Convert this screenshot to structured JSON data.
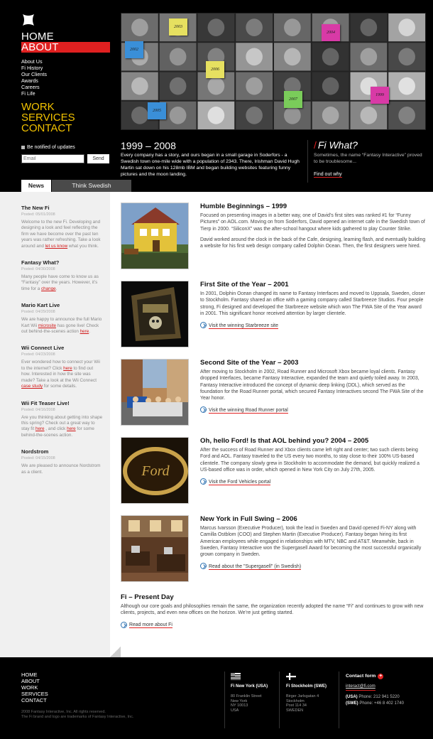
{
  "header": {
    "nav_main": [
      "HOME",
      "ABOUT"
    ],
    "sub_nav": [
      "About Us",
      "Fi History",
      "Our Clients",
      "Awards",
      "Careers",
      "Fi Life"
    ],
    "nav_lower": [
      "WORK",
      "SERVICES",
      "CONTACT"
    ],
    "notify_label": "Be notified of updates",
    "email_placeholder": "Email",
    "send_label": "Send",
    "tabs": [
      "News",
      "Think Swedish"
    ],
    "collage_notes": [
      "2002",
      "2003",
      "2004",
      "2006",
      "2005",
      "2007",
      "1999"
    ],
    "colors": {
      "accent": "#e02020",
      "nav_yellow": "#f2c200",
      "note_blue": "#3a8fd8",
      "note_yellow": "#e6e060",
      "note_pink": "#d83aa6",
      "note_green": "#7acc5a"
    }
  },
  "hero": {
    "year": "1999 – 2008",
    "text": "Every company has a story, and ours began in a small garage in Soderfors - a Swedish town one-mile wide with a population of 2343. There, Irishman David Hugh Martin sat down on his 128mb IBM and began building websites featuring funny pictures and the moon landing."
  },
  "whatfi": {
    "title": "Fi What?",
    "text": "Sometimes, the name “Fantasy Interactive” proved to be troublesome...",
    "link": "Find out why"
  },
  "news": [
    {
      "title": "The New Fi",
      "date": "Posted: 05/01/2008",
      "pre": "Welcome to the new Fi. Developing and designing a look and feel reflecting the firm we have become over the past ten years was rather refreshing. Take a look around and ",
      "link": "let us know",
      "post": " what you think."
    },
    {
      "title": "Fantasy What?",
      "date": "Posted: 04/30/2008",
      "pre": "Many people have come to know us as “Fantasy” over the years. However, it’s time for a ",
      "link": "change",
      "post": "."
    },
    {
      "title": "Mario Kart Live",
      "date": "Posted: 04/29/2008",
      "pre": "We are happy to announce the full Mario Kart Wii ",
      "link": "microsite",
      "post": " has gone live! Check out behind-the-scenes action ",
      "link2": "here",
      "post2": "."
    },
    {
      "title": "Wii Connect Live",
      "date": "Posted: 04/23/2008",
      "pre": "Ever wondered how to connect your Wii to the internet? Click ",
      "link": "here",
      "post": " to find out how. Interested in how the site was made? Take a look at the Wii Connect ",
      "link2": "case study",
      "post2": " for some details."
    },
    {
      "title": "Wii Fit Teaser Live!",
      "date": "Posted: 04/16/2008",
      "pre": "Are you thinking about getting into shape this spring? Check out a great way to stay fit ",
      "link": "here",
      "post": " , and click ",
      "link2": "here",
      "post2": " for some behind-the-scenes action."
    },
    {
      "title": "Nordstrom",
      "date": "Posted: 04/15/2008",
      "pre": "We are pleased to announce Nordstrom as a client.",
      "link": "",
      "post": ""
    }
  ],
  "stories": [
    {
      "title": "Humble Beginnings – 1999",
      "paragraphs": [
        "Focused on presenting images in a better way, one of David’s first sites was ranked #1 for “Funny Pictures” on AOL.com. Moving on from Soderfors, David opened an internet cafe in the Swedish town of Tierp in 2000. “SiliconX” was the after-school hangout where kids gathered to play Counter Strike.",
        "David worked around the clock in the back of the Cafe, designing, learning flash, and eventually building a website for his first web design company called Dolphin Ocean. Then, the first designers were hired."
      ],
      "link": ""
    },
    {
      "title": "First Site of the Year – 2001",
      "paragraphs": [
        "In 2001, Dolphin Ocean changed its name to Fantasy Interfaces and moved to Uppsala, Sweden, closer to Stockholm. Fantasy shared an office with a gaming company called Starbreeze Studios. Four people strong, Fi designed and developed the Starbreeze website which won The FWA Site of the Year award in 2001. This significant honor received attention by larger clientele."
      ],
      "link": "Visit the winning Starbreeze site"
    },
    {
      "title": "Second Site of the Year – 2003",
      "paragraphs": [
        "After moving to Stockholm in 2002, Road Runner and Microsoft Xbox became loyal clients. Fantasy dropped Interfaces, became Fantasy Interactive, expanded the team and quietly toiled away. In 2003, Fantasy Interactive introduced the concept of dynamic deep linking (DDL), which served as the foundation for the Road Runner portal, which secured Fantasy Interactives second The FWA Site of the Year honor."
      ],
      "link": "Visit the winning Road Runner portal"
    },
    {
      "title": "Oh, hello Ford! Is that AOL behind you? 2004 – 2005",
      "paragraphs": [
        "After the success of Road Runner and Xbox clients came left right and center; two such clients being Ford and AOL. Fantasy traveled to the US every two months, to stay close to their 100% US-based clientele. The company slowly grew in Stockholm to accommodate the demand, but quickly realized a US-based office was in order, which opened in New York City on July 27th, 2005."
      ],
      "link": "Visit the Ford Vehicles portal"
    },
    {
      "title": "New York in Full Swing – 2006",
      "paragraphs": [
        "Marcus Ivarsson (Executive Producer), took the lead in Sweden and David opened Fi-NY along with Camilla Ostblom (COO) and Stephen Martin (Executive Producer). Fantasy began hiring its first American employees while engaged in relationships with MTV, NBC and AT&T. Meanwhile, back in Sweden, Fantasy Interactive won the Supergasell Award for becoming the most successful organically grown company in Sweden."
      ],
      "link": "Read about the \"Supergasell\" (in Swedish)"
    }
  ],
  "present": {
    "title": "Fi – Present Day",
    "text": "Although our core goals and philosophies remain the same, the organization recently adopted the name “Fi” and continues to grow with new clients, projects, and even new offices on the horizon. We’re just getting started.",
    "link": "Read more about Fi"
  },
  "footer": {
    "nav": [
      "HOME",
      "ABOUT",
      "WORK",
      "SERVICES",
      "CONTACT"
    ],
    "copyright_1": "2008 Fantasy Interactive, Inc. All rights reserved.",
    "copyright_2": "The Fi brand and logo are trademarks of Fantasy Interactive, Inc.",
    "office_ny": {
      "title": "Fi New York (USA)",
      "lines": [
        "80 Franklin Street",
        "New York",
        "NY 10013",
        "USA"
      ]
    },
    "office_se": {
      "title": "Fi Stockholm (SWE)",
      "lines": [
        "Birger Jarlsgatan 4",
        "Stockholm",
        "Post 114 34",
        "SWEDEN"
      ]
    },
    "contact": {
      "title": "Contact form",
      "email": "interact@fi.com",
      "usa_label": "(USA)",
      "usa_phone": "Phone: 212 941 5220",
      "swe_label": "(SWE)",
      "swe_phone": "Phone: +46 8 402 1740"
    }
  }
}
